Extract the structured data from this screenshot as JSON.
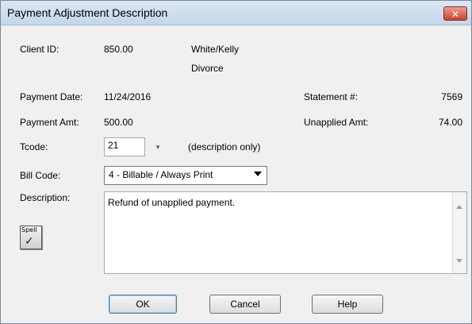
{
  "window": {
    "title": "Payment Adjustment Description",
    "close_icon": "close-icon",
    "close_glyph": "✕"
  },
  "client": {
    "label": "Client ID:",
    "id": "850.00",
    "name": "White/Kelly",
    "matter": "Divorce"
  },
  "payment": {
    "date_label": "Payment Date:",
    "date": "11/24/2016",
    "amount_label": "Payment Amt:",
    "amount": "500.00"
  },
  "statement": {
    "label": "Statement #:",
    "value": "7569"
  },
  "unapplied": {
    "label": "Unapplied Amt:",
    "value": "74.00"
  },
  "tcode": {
    "label": "Tcode:",
    "value": "21",
    "note": "(description only)"
  },
  "bill_code": {
    "label": "Bill Code:",
    "selected": "4 - Billable / Always Print"
  },
  "description": {
    "label": "Description:",
    "text": "Refund of unapplied payment."
  },
  "spell": {
    "label": "Spell",
    "icon": "spell-check-icon"
  },
  "buttons": {
    "ok": "OK",
    "cancel": "Cancel",
    "help": "Help"
  }
}
